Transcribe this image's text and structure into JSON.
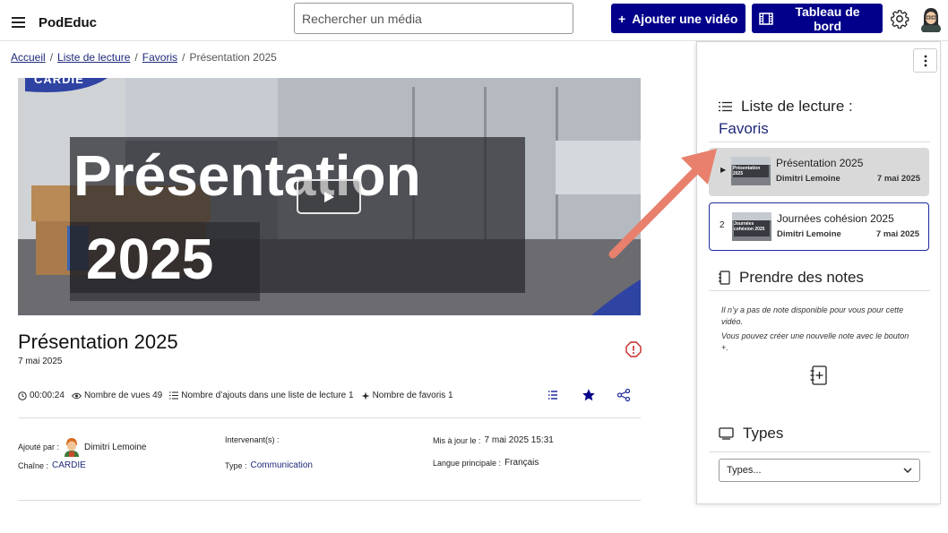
{
  "header": {
    "brand": "PodEduc",
    "search_placeholder": "Rechercher un média",
    "add_video_label": "Ajouter une vidéo",
    "dashboard_label": "Tableau de bord"
  },
  "breadcrumb": {
    "home": "Accueil",
    "playlists": "Liste de lecture",
    "favorites": "Favoris",
    "current": "Présentation 2025"
  },
  "video": {
    "overlay_line1": "Présentation",
    "overlay_line2": "2025",
    "logo_text": "CARDIE"
  },
  "media": {
    "title": "Présentation 2025",
    "date": "7 mai 2025",
    "duration": "00:00:24",
    "views": "Nombre de vues 49",
    "playlist_adds": "Nombre d’ajouts dans une liste de lecture 1",
    "favorites": "Nombre de favoris 1"
  },
  "meta": {
    "added_by_label": "Ajouté par :",
    "added_by_value": "Dimitri Lemoine",
    "channel_label": "Chaîne :",
    "channel_value": "CARDIE",
    "speakers_label": "Intervenant(s) :",
    "type_label": "Type :",
    "type_value": "Communication",
    "updated_label": "Mis à jour le :",
    "updated_value": "7 mai 2025 15:31",
    "language_label": "Langue principale :",
    "language_value": "Français"
  },
  "sidebar": {
    "playlist_heading": "Liste de lecture :",
    "playlist_name": "Favoris",
    "items": [
      {
        "marker": "▶",
        "title": "Présentation 2025",
        "author": "Dimitri Lemoine",
        "date": "7 mai 2025",
        "thumb_text": "Présentation 2025"
      },
      {
        "marker": "2",
        "title": "Journées cohésion 2025",
        "author": "Dimitri Lemoine",
        "date": "7 mai 2025",
        "thumb_text": "Journées cohésion 2025"
      }
    ],
    "notes_heading": "Prendre des notes",
    "notes_empty_1": "Il n’y a pas de note disponible pour vous pour cette vidéo.",
    "notes_empty_2": "Vous pouvez créer une nouvelle note avec le bouton +.",
    "types_heading": "Types",
    "types_select": "Types..."
  },
  "colors": {
    "primary": "#02008a",
    "link": "#1f2a7a",
    "favorite_star": "#02008a",
    "report": "#c62828",
    "arrow": "#e8806d"
  }
}
